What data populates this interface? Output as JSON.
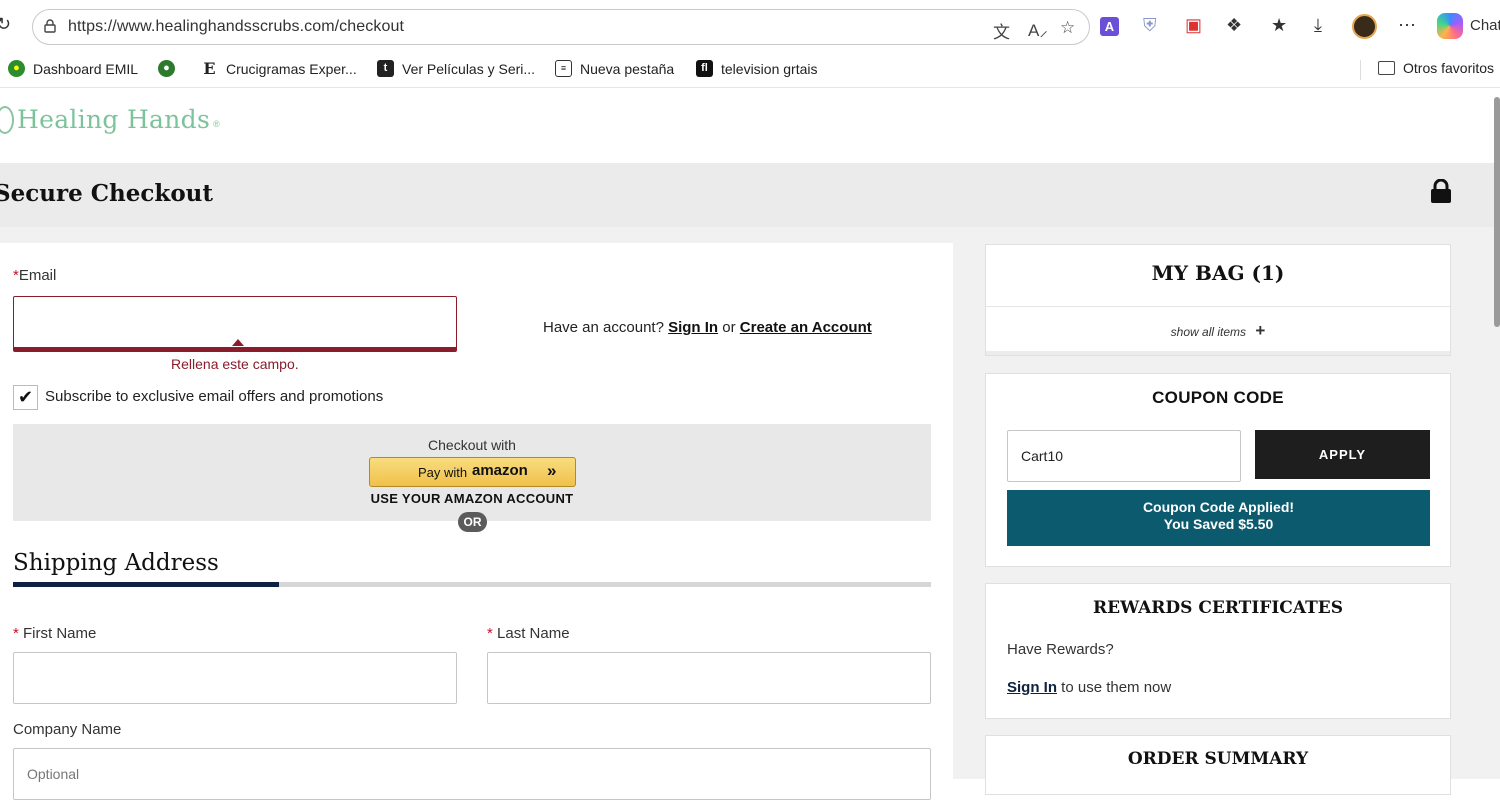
{
  "browser": {
    "url": "https://www.healinghandsscrubs.com/checkout",
    "chat_label": "Chat",
    "bookmarks": [
      {
        "label": "Dashboard EMIL"
      },
      {
        "label": ""
      },
      {
        "label": "Crucigramas Exper..."
      },
      {
        "label": "Ver Películas y Seri..."
      },
      {
        "label": "Nueva pestaña"
      },
      {
        "label": "television grtais"
      }
    ],
    "other_favorites": "Otros favoritos"
  },
  "site": {
    "logo_text": "Healing Hands",
    "logo_mark": "®"
  },
  "header": {
    "title": "Secure Checkout"
  },
  "email_section": {
    "required_mark": "*",
    "email_label": "Email",
    "email_value": "",
    "error_message": "Rellena este campo.",
    "have_account": "Have an account?",
    "sign_in": "Sign In",
    "or": "or",
    "create_account": "Create an Account",
    "subscribe_label": "Subscribe to exclusive email offers and promotions",
    "subscribe_checked": true
  },
  "amazon": {
    "checkout_with": "Checkout with",
    "pay_with": "Pay with",
    "amazon": "amazon",
    "use_account": "USE YOUR AMAZON ACCOUNT",
    "or_badge": "OR"
  },
  "shipping": {
    "title": "Shipping Address",
    "required_mark": "*",
    "first_name_label": "First Name",
    "last_name_label": "Last Name",
    "company_label": "Company Name",
    "company_placeholder": "Optional"
  },
  "bag": {
    "title": "MY BAG (1)",
    "show_all": "show all items",
    "plus": "+"
  },
  "coupon": {
    "title": "COUPON CODE",
    "value": "Cart10",
    "apply": "APPLY",
    "applied_line1": "Coupon Code Applied!",
    "applied_line2": "You Saved $5.50"
  },
  "rewards": {
    "title": "REWARDS CERTIFICATES",
    "have_rewards": "Have Rewards?",
    "sign_in": "Sign In",
    "suffix": "to use them now"
  },
  "summary": {
    "title": "ORDER SUMMARY"
  },
  "colors": {
    "accent_error": "#8a1c2b",
    "navy": "#0d2240",
    "teal": "#0b5a6e",
    "logo_green": "#7cc39b"
  }
}
